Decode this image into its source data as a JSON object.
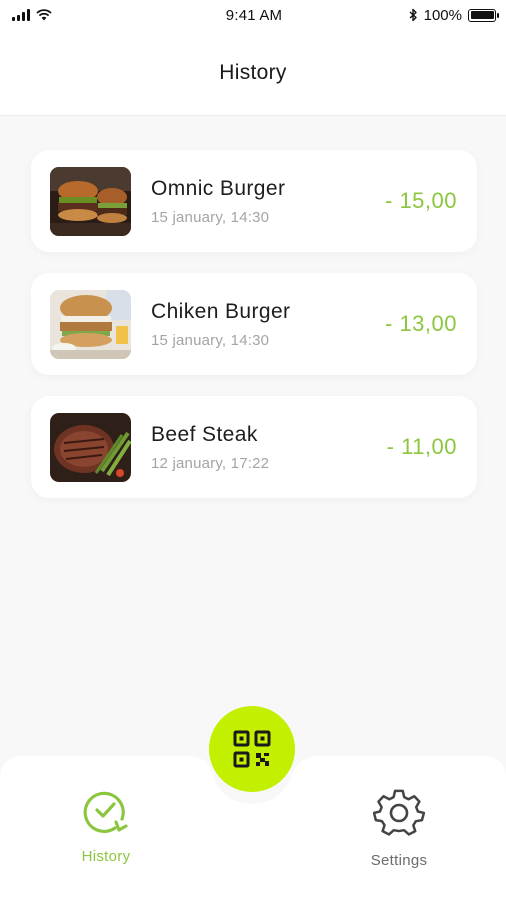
{
  "status_bar": {
    "time": "9:41 AM",
    "battery": "100%"
  },
  "header": {
    "title": "History"
  },
  "history": [
    {
      "name": "Omnic Burger",
      "date": "15 january, 14:30",
      "price": "- 15,00",
      "image": "omnic-burger-photo"
    },
    {
      "name": "Chiken Burger",
      "date": "15 january, 14:30",
      "price": "- 13,00",
      "image": "chicken-burger-photo"
    },
    {
      "name": "Beef Steak",
      "date": "12 january, 17:22",
      "price": "- 11,00",
      "image": "beef-steak-photo"
    }
  ],
  "tabbar": {
    "history_label": "History",
    "settings_label": "Settings",
    "scan_icon": "qr-code-icon"
  },
  "colors": {
    "accent": "#8cc63f",
    "scan_button": "#c3ef00",
    "date_text": "#a4a4a4",
    "inactive_tab": "#6b6b6b"
  }
}
